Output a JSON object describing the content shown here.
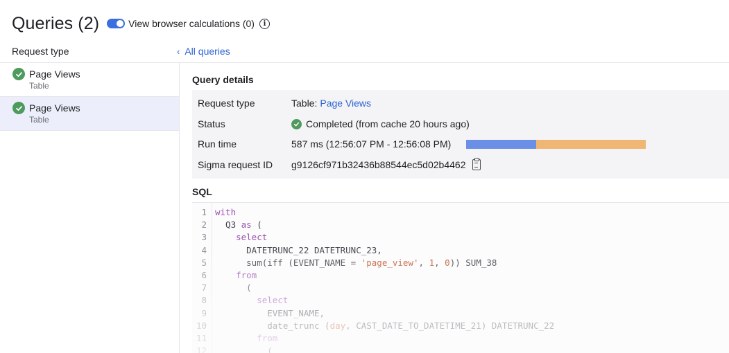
{
  "header": {
    "title": "Queries (2)",
    "toggle_label": "View browser calculations (0)",
    "toggle_on": true,
    "info_icon": "info-icon"
  },
  "sidebar": {
    "column_header": "Request type",
    "items": [
      {
        "title": "Page Views",
        "subtitle": "Table",
        "status_icon": "check-circle-icon",
        "selected": false
      },
      {
        "title": "Page Views",
        "subtitle": "Table",
        "status_icon": "check-circle-icon",
        "selected": true
      }
    ]
  },
  "nav": {
    "back_link": "All queries",
    "back_icon": "chevron-left-icon"
  },
  "details": {
    "section_title": "Query details",
    "request_type_label": "Request type",
    "request_type_prefix": "Table:",
    "request_type_link": "Page Views",
    "status_label": "Status",
    "status_value": "Completed (from cache 20 hours ago)",
    "run_time_label": "Run time",
    "run_time_value": "587 ms (12:56:07 PM - 12:56:08 PM)",
    "run_time_split": [
      0.39,
      0.61
    ],
    "run_time_colors": [
      "#6b8fe6",
      "#f0b673"
    ],
    "request_id_label": "Sigma request ID",
    "request_id_value": "g9126cf971b32436b88544ec5d02b4462",
    "copy_icon": "clipboard-icon"
  },
  "sql": {
    "section_title": "SQL",
    "lines": [
      {
        "n": "1",
        "segs": [
          [
            "kw",
            "with"
          ]
        ]
      },
      {
        "n": "2",
        "segs": [
          [
            "",
            "  Q3 "
          ],
          [
            "kw",
            "as"
          ],
          [
            "",
            " ("
          ]
        ]
      },
      {
        "n": "3",
        "segs": [
          [
            "",
            "    "
          ],
          [
            "kw",
            "select"
          ]
        ]
      },
      {
        "n": "4",
        "segs": [
          [
            "",
            "      DATETRUNC_22 DATETRUNC_23,"
          ]
        ]
      },
      {
        "n": "5",
        "segs": [
          [
            "",
            "      sum(iff (EVENT_NAME = "
          ],
          [
            "str",
            "'page_view'"
          ],
          [
            "",
            ", "
          ],
          [
            "num",
            "1"
          ],
          [
            "",
            ", "
          ],
          [
            "num",
            "0"
          ],
          [
            "",
            ")) SUM_38"
          ]
        ]
      },
      {
        "n": "6",
        "segs": [
          [
            "",
            "    "
          ],
          [
            "kw",
            "from"
          ]
        ]
      },
      {
        "n": "7",
        "segs": [
          [
            "",
            "      ("
          ]
        ]
      },
      {
        "n": "8",
        "segs": [
          [
            "",
            "        "
          ],
          [
            "kw",
            "select"
          ]
        ]
      },
      {
        "n": "9",
        "segs": [
          [
            "",
            "          EVENT_NAME,"
          ]
        ]
      },
      {
        "n": "10",
        "segs": [
          [
            "",
            "          date_trunc ("
          ],
          [
            "str",
            "day"
          ],
          [
            "",
            ", CAST_DATE_TO_DATETIME_21) DATETRUNC_22"
          ]
        ]
      },
      {
        "n": "11",
        "segs": [
          [
            "",
            "        "
          ],
          [
            "kw",
            "from"
          ]
        ]
      },
      {
        "n": "12",
        "segs": [
          [
            "",
            "          ("
          ]
        ]
      }
    ]
  }
}
